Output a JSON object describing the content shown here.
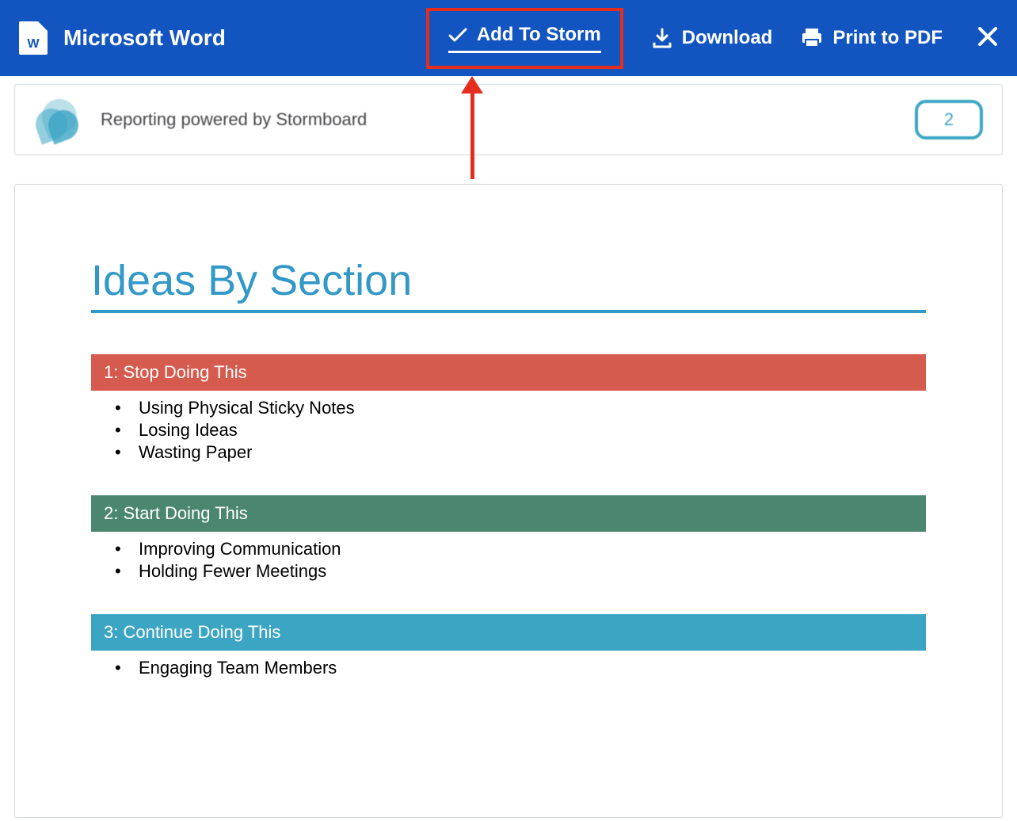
{
  "toolbar": {
    "app_title": "Microsoft Word",
    "word_icon_letter": "W",
    "add_to_storm": "Add To Storm",
    "download": "Download",
    "print_to_pdf": "Print to PDF"
  },
  "header_card": {
    "powered_text": "Reporting powered by Stormboard",
    "page_number": "2"
  },
  "document": {
    "title": "Ideas By Section",
    "sections": [
      {
        "header": "1: Stop Doing This",
        "color": "red",
        "items": [
          "Using Physical Sticky Notes",
          "Losing Ideas",
          "Wasting Paper"
        ]
      },
      {
        "header": "2: Start Doing This",
        "color": "green",
        "items": [
          "Improving Communication",
          "Holding Fewer Meetings"
        ]
      },
      {
        "header": "3: Continue Doing This",
        "color": "blue",
        "items": [
          "Engaging Team Members"
        ]
      }
    ]
  },
  "colors": {
    "toolbar_bg": "#1355c0",
    "highlight": "#e52d1e",
    "accent": "#3da5c4",
    "section_red": "#d55b4e",
    "section_green": "#4b876f",
    "section_blue": "#3da5c4"
  }
}
